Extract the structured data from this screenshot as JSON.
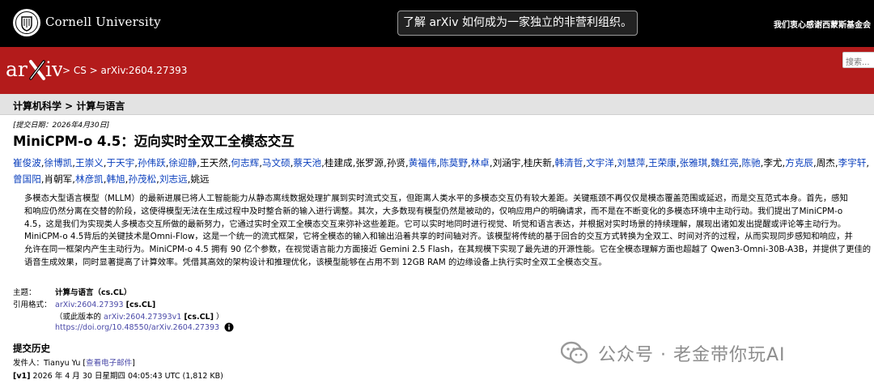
{
  "topbar": {
    "university": "Cornell University",
    "promo": "了解 arXiv 如何成为一家独立的非营利组织。",
    "thanks": "我们衷心感谢西蒙斯基金会"
  },
  "header": {
    "logo_text": "arXiv",
    "breadcrumb": "> CS > arXiv:2604.27393",
    "search_placeholder": "搜索..."
  },
  "subheader": {
    "text": "计算机科学 > 计算与语言"
  },
  "paper": {
    "submitted": "[提交日期：2026年4月30日]",
    "title": "MiniCPM-o 4.5：迈向实时全双工全模态交互",
    "authors": [
      {
        "name": "崔俊波",
        "link": true
      },
      {
        "name": "徐博凯",
        "link": true
      },
      {
        "name": "王崇义",
        "link": true
      },
      {
        "name": "于天宇",
        "link": true
      },
      {
        "name": "孙伟跃",
        "link": true
      },
      {
        "name": "徐迎静",
        "link": true
      },
      {
        "name": "王天然",
        "link": false
      },
      {
        "name": "何志辉",
        "link": true
      },
      {
        "name": "马文硕",
        "link": true
      },
      {
        "name": "蔡天池",
        "link": true
      },
      {
        "name": "桂建成",
        "link": false
      },
      {
        "name": "张罗源",
        "link": false
      },
      {
        "name": "孙贤",
        "link": false
      },
      {
        "name": "黄福伟",
        "link": true
      },
      {
        "name": "陈莫野",
        "link": true
      },
      {
        "name": "林卓",
        "link": true
      },
      {
        "name": "刘涵宇",
        "link": false
      },
      {
        "name": "桂庆新",
        "link": false
      },
      {
        "name": "韩清哲",
        "link": true
      },
      {
        "name": "文宇洋",
        "link": true
      },
      {
        "name": "刘慧萍",
        "link": true
      },
      {
        "name": "王荣康",
        "link": true
      },
      {
        "name": "张雅琪",
        "link": true
      },
      {
        "name": "魏红亮",
        "link": true
      },
      {
        "name": "陈驰",
        "link": true
      },
      {
        "name": "李尤",
        "link": false
      },
      {
        "name": "方克辰",
        "link": true
      },
      {
        "name": "周杰",
        "link": false
      },
      {
        "name": "李宇轩",
        "link": true
      },
      {
        "name": "曾国阳",
        "link": true
      },
      {
        "name": "肖朝军",
        "link": false
      },
      {
        "name": "林彦凯",
        "link": true
      },
      {
        "name": "韩旭",
        "link": true
      },
      {
        "name": "孙茂松",
        "link": true
      },
      {
        "name": "刘志远",
        "link": true
      },
      {
        "name": "姚远",
        "link": false
      }
    ],
    "abstract_lines": [
      "多模态大型语言模型（MLLM）的最新进展已将人工智能能力从静态离线数据处理扩展到实时流式交互，但距离人类水平的多模态交互仍有较大差距。关键瓶颈不再仅仅是模态覆盖范围或延迟，而是交互范式本身。首先，感知",
      "和响应仍然分离在交替的阶段，这使得模型无法在生成过程中及时整合新的输入进行调整。其次，大多数现有模型仍然是被动的，仅响应用户的明确请求，而不是在不断变化的多模态环境中主动行动。我们提出了MiniCPM-o",
      "4.5，这是我们为实现类人多模态交互所做的最新努力，它通过实时全双工全模态交互来弥补这些差距。它可以实时地同时进行视觉、听觉和语言表达，并根据对实时场景的持续理解，展现出诸如发出提醒或评论等主动行为。",
      "MiniCPM-o 4.5背后的关键技术是Omni-Flow，这是一个统一的流式框架，它将全模态的输入和输出沿着共享的时间轴对齐。该模型将传统的基于回合的交互方式转换为全双工、时间对齐的过程，从而实现同步感知和响应，并",
      "允许在同一框架内产生主动行为。MiniCPM-o 4.5 拥有 90 亿个参数，在视觉语言能力方面接近 Gemini 2.5 Flash，在其规模下实现了最先进的开源性能。它在全模态理解方面也超越了 Qwen3-Omni-30B-A3B，并提供了更佳的",
      "语音生成效果，同时显著提高了计算效率。凭借其高效的架构设计和推理优化，该模型能够在占用不到 12GB RAM 的边缘设备上执行实时全双工全模态交互。"
    ]
  },
  "meta": {
    "subject_label": "主题：",
    "subject_value": "计算与语言（cs.CL）",
    "cite_label": "引用格式：",
    "cite_link": "arXiv:2604.27393",
    "cite_tag": "[cs.CL]",
    "version_prefix": "（或此版本的",
    "version_link": "arXiv:2604.27393v1",
    "version_tag": "[cs.CL]",
    "version_suffix": "）",
    "doi": "https://doi.org/10.48550/arXiv.2604.27393"
  },
  "history": {
    "heading": "提交历史",
    "sender_prefix": "发件人：Tianyu Yu [",
    "sender_link": "查看电子邮件",
    "sender_suffix": "]",
    "v1_tag": "[v1]",
    "v1_text": "2026 年 4 月 30 日星期四 04:05:43 UTC (1,812 KB)"
  },
  "watermark": {
    "text": "公众号 · 老金带你玩AI"
  },
  "colors": {
    "arxiv_red": "#b31b1b",
    "author_link": "#0a3fbd",
    "link": "#4a49a8"
  }
}
